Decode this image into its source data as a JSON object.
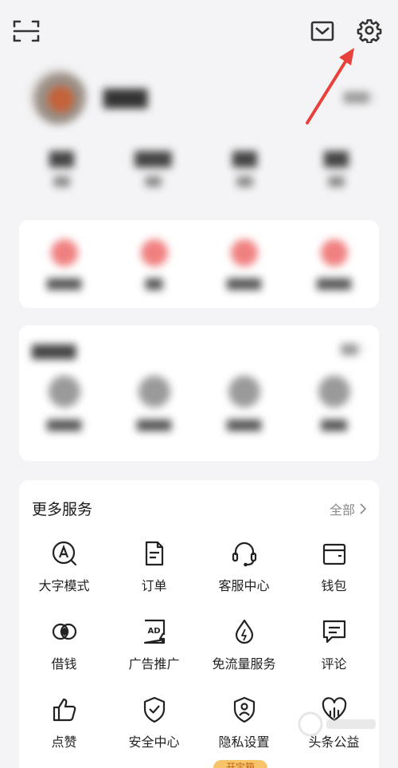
{
  "top_bar": {
    "icons": [
      "scan-icon",
      "mail-icon",
      "settings-gear-icon"
    ]
  },
  "more_services": {
    "title": "更多服务",
    "all_label": "全部",
    "items": [
      {
        "label": "大字模式",
        "icon": "large-font-mode-icon"
      },
      {
        "label": "订单",
        "icon": "order-document-icon"
      },
      {
        "label": "客服中心",
        "icon": "headset-icon"
      },
      {
        "label": "钱包",
        "icon": "wallet-icon"
      },
      {
        "label": "借钱",
        "icon": "borrow-money-icon"
      },
      {
        "label": "广告推广",
        "icon": "ad-promotion-icon"
      },
      {
        "label": "免流量服务",
        "icon": "free-data-drop-icon"
      },
      {
        "label": "评论",
        "icon": "comment-icon"
      },
      {
        "label": "点赞",
        "icon": "thumbs-up-icon"
      },
      {
        "label": "安全中心",
        "icon": "shield-check-icon"
      },
      {
        "label": "隐私设置",
        "icon": "privacy-user-shield-icon"
      },
      {
        "label": "头条公益",
        "icon": "charity-heart-chart-icon"
      }
    ]
  },
  "promo_pill": {
    "label": "开宝箱"
  },
  "annotation": {
    "color": "#e8403a",
    "icon": "red-arrow-pointing-to-settings"
  },
  "colors": {
    "accent_red": "#e8403a",
    "promo_orange": "#f7c46a",
    "background": "#f4f4f6"
  }
}
